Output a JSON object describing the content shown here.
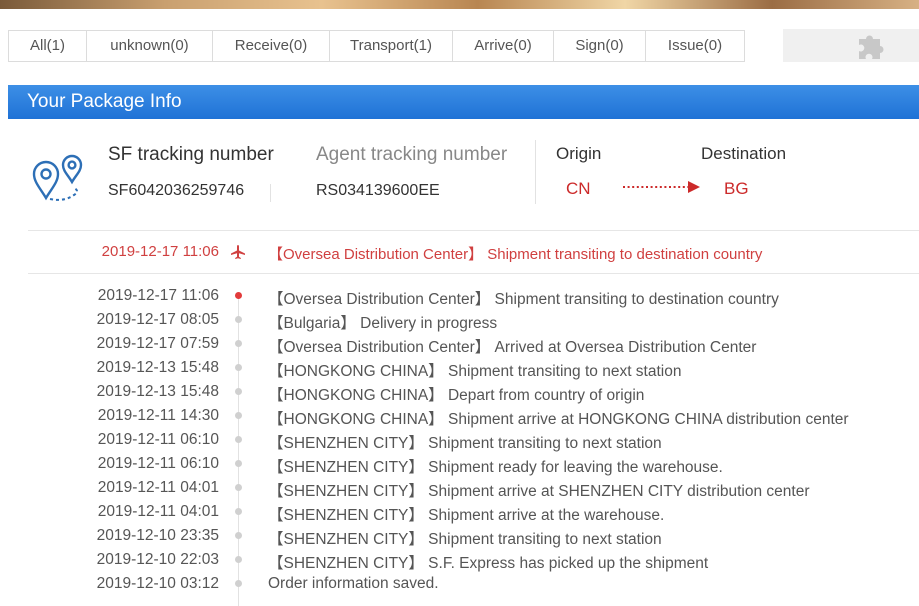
{
  "tabs": [
    {
      "label": "All(1)"
    },
    {
      "label": "unknown(0)"
    },
    {
      "label": "Receive(0)"
    },
    {
      "label": "Transport(1)"
    },
    {
      "label": "Arrive(0)"
    },
    {
      "label": "Sign(0)"
    },
    {
      "label": "Issue(0)"
    }
  ],
  "panel": {
    "title": "Your Package Info"
  },
  "package": {
    "sf_label": "SF tracking number",
    "sf_number": "SF6042036259746",
    "agent_label": "Agent tracking number",
    "agent_number": "RS034139600EE",
    "origin_label": "Origin",
    "destination_label": "Destination",
    "origin": "CN",
    "destination": "BG"
  },
  "latest": {
    "time": "2019-12-17 11:06",
    "message": "【Oversea Distribution Center】 Shipment transiting to destination country"
  },
  "events": [
    {
      "time": "2019-12-17 11:06",
      "message": "【Oversea Distribution Center】 Shipment transiting to destination country",
      "active": true
    },
    {
      "time": "2019-12-17 08:05",
      "message": "【Bulgaria】 Delivery in progress",
      "active": false
    },
    {
      "time": "2019-12-17 07:59",
      "message": "【Oversea Distribution Center】 Arrived at Oversea Distribution Center",
      "active": false
    },
    {
      "time": "2019-12-13 15:48",
      "message": "【HONGKONG CHINA】 Shipment transiting to next station",
      "active": false
    },
    {
      "time": "2019-12-13 15:48",
      "message": "【HONGKONG CHINA】 Depart from country of origin",
      "active": false
    },
    {
      "time": "2019-12-11 14:30",
      "message": "【HONGKONG CHINA】 Shipment arrive at HONGKONG CHINA distribution center",
      "active": false
    },
    {
      "time": "2019-12-11 06:10",
      "message": "【SHENZHEN CITY】 Shipment transiting to next station",
      "active": false
    },
    {
      "time": "2019-12-11 06:10",
      "message": "【SHENZHEN CITY】 Shipment ready for leaving the warehouse.",
      "active": false
    },
    {
      "time": "2019-12-11 04:01",
      "message": "【SHENZHEN CITY】 Shipment arrive at SHENZHEN CITY distribution center",
      "active": false
    },
    {
      "time": "2019-12-11 04:01",
      "message": "【SHENZHEN CITY】 Shipment arrive at the warehouse.",
      "active": false
    },
    {
      "time": "2019-12-10 23:35",
      "message": "【SHENZHEN CITY】 Shipment transiting to next station",
      "active": false
    },
    {
      "time": "2019-12-10 22:03",
      "message": "【SHENZHEN CITY】 S.F. Express has picked up the shipment",
      "active": false
    },
    {
      "time": "2019-12-10 03:12",
      "message": "Order information saved.",
      "active": false
    }
  ],
  "colors": {
    "accent": "#1f72d6",
    "alert": "#d04040",
    "dot_active": "#e23b3b",
    "dot_idle": "#d0d0d0"
  }
}
